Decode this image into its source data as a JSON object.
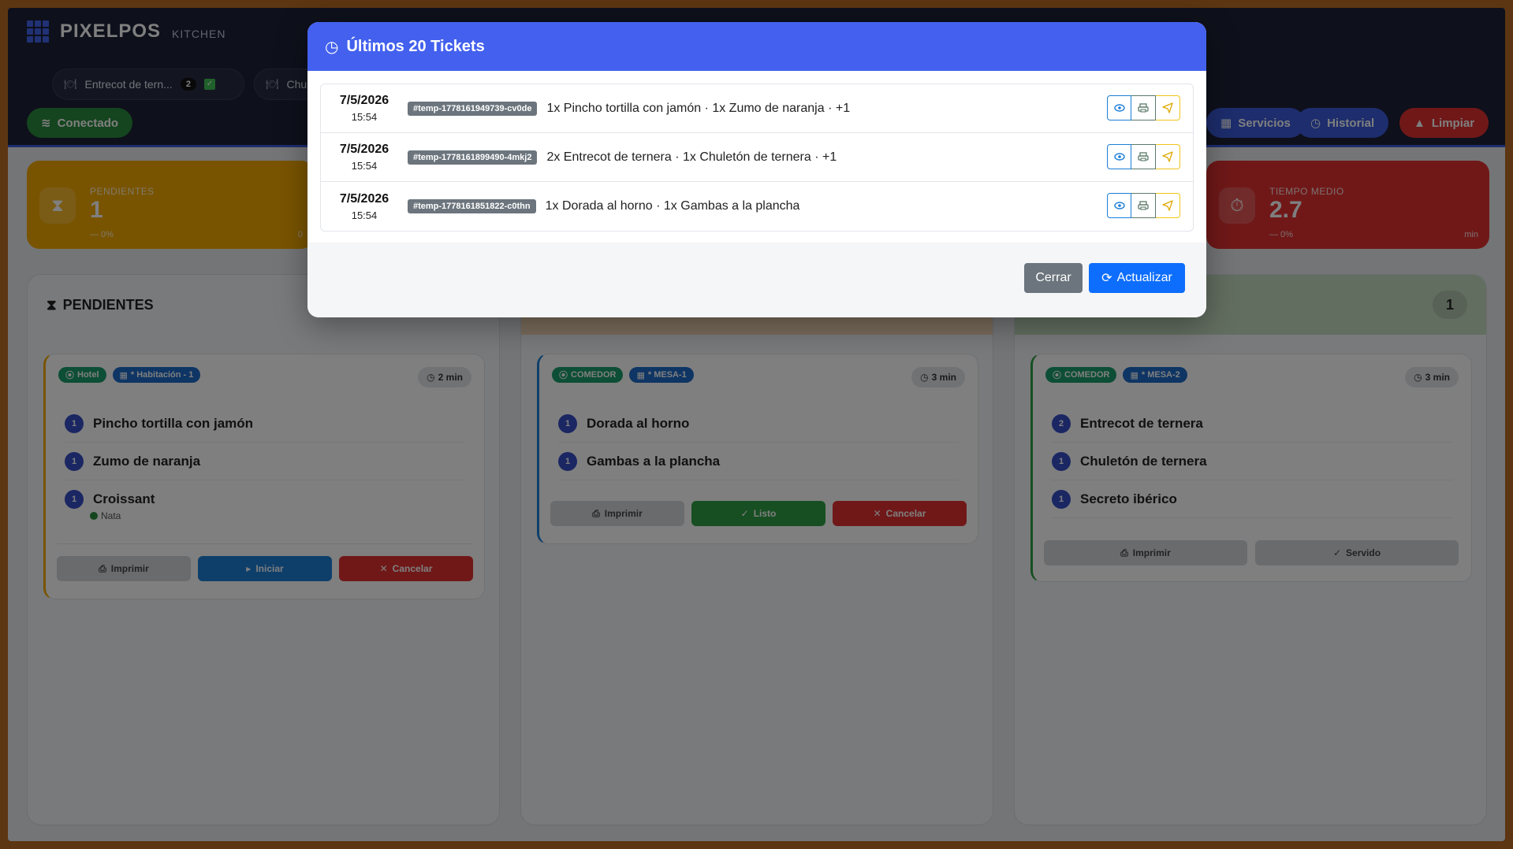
{
  "brand": {
    "name": "PIXELPOS",
    "sub": "KITCHEN"
  },
  "header": {
    "chips": [
      {
        "label": "Entrecot de tern...",
        "count": "2"
      },
      {
        "label": "Chu"
      }
    ],
    "status": "Conectado",
    "buttons": {
      "servicios": "Servicios",
      "historial": "Historial",
      "limpiar": "Limpiar"
    }
  },
  "stats": [
    {
      "label": "PENDIENTES",
      "value": "1",
      "sub": "— 0%",
      "sub2": "0",
      "color": "#f2a900"
    },
    {
      "label": "TIEMPO MEDIO",
      "value": "2.7",
      "sub": "— 0%",
      "sub2": "min",
      "color": "#e03131"
    }
  ],
  "columns": {
    "pending": {
      "title": "PENDIENTES"
    },
    "ready": {
      "count": "1"
    }
  },
  "tickets": [
    {
      "location": "Hotel",
      "table": "* Habitación - 1",
      "time": "2 min",
      "items": [
        {
          "qty": "1",
          "name": "Pincho tortilla con jamón"
        },
        {
          "qty": "1",
          "name": "Zumo de naranja"
        },
        {
          "qty": "1",
          "name": "Croissant",
          "note": "Nata"
        }
      ],
      "actions": {
        "print": "Imprimir",
        "start": "Iniciar",
        "cancel": "Cancelar"
      }
    },
    {
      "location": "COMEDOR",
      "table": "* MESA-1",
      "time": "3 min",
      "items": [
        {
          "qty": "1",
          "name": "Dorada al horno"
        },
        {
          "qty": "1",
          "name": "Gambas a la plancha"
        }
      ],
      "actions": {
        "print": "Imprimir",
        "ready": "Listo",
        "cancel": "Cancelar"
      }
    },
    {
      "location": "COMEDOR",
      "table": "* MESA-2",
      "time": "3 min",
      "items": [
        {
          "qty": "2",
          "name": "Entrecot de ternera"
        },
        {
          "qty": "1",
          "name": "Chuletón de ternera"
        },
        {
          "qty": "1",
          "name": "Secreto ibérico"
        }
      ],
      "actions": {
        "print": "Imprimir",
        "served": "Servido"
      }
    }
  ],
  "modal": {
    "title": "Últimos 20 Tickets",
    "rows": [
      {
        "date": "7/5/2026",
        "time": "15:54",
        "id": "#temp-1778161949739-cv0de",
        "desc": "1x Pincho tortilla con jamón · 1x Zumo de naranja · +1"
      },
      {
        "date": "7/5/2026",
        "time": "15:54",
        "id": "#temp-1778161899490-4mkj2",
        "desc": "2x Entrecot de ternera · 1x Chuletón de ternera · +1"
      },
      {
        "date": "7/5/2026",
        "time": "15:54",
        "id": "#temp-1778161851822-c0thn",
        "desc": "1x Dorada al horno · 1x Gambas a la plancha"
      }
    ],
    "close": "Cerrar",
    "refresh": "Actualizar"
  },
  "colors": {
    "accent": "#4361ee",
    "pending": "#f2a900",
    "danger": "#e03131",
    "success": "#2f9e44",
    "primary": "#1c7ed6"
  }
}
